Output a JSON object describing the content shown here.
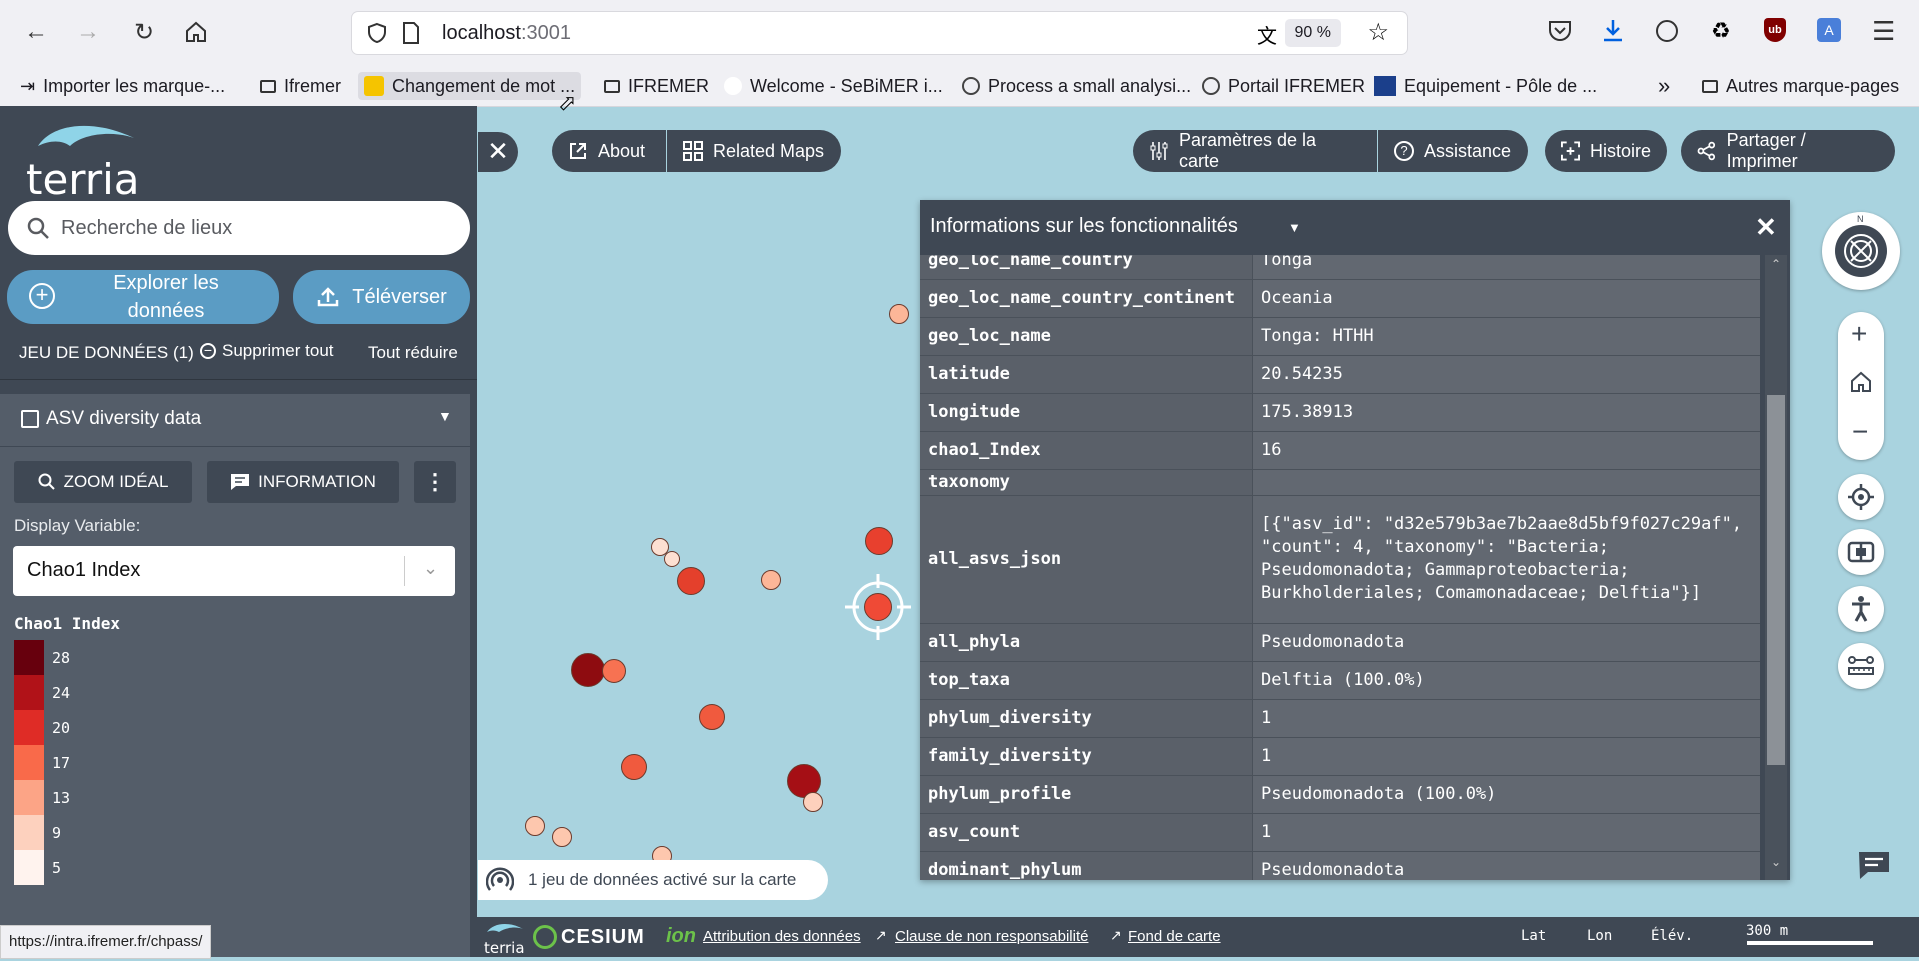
{
  "browser": {
    "url_host": "localhost",
    "url_port": ":3001",
    "zoom": "90 %",
    "bookmarks": [
      {
        "label": "Importer les marque-...",
        "icon": "import-icon"
      },
      {
        "label": "Ifremer",
        "icon": "folder-icon"
      },
      {
        "label": "Changement de mot ...",
        "icon": "ifremer-favicon"
      },
      {
        "label": "IFREMER",
        "icon": "folder-icon"
      },
      {
        "label": "Welcome - SeBiMER i...",
        "icon": "blank-favicon"
      },
      {
        "label": "Process a small analysi...",
        "icon": "globe-icon"
      },
      {
        "label": "Portail IFREMER",
        "icon": "globe-icon"
      },
      {
        "label": "Equipement - Pôle de ...",
        "icon": "site-favicon"
      },
      {
        "label": "Autres marque-pages",
        "icon": "folder-icon"
      }
    ],
    "status_url": "https://intra.ifremer.fr/chpass/"
  },
  "sidebar": {
    "logo_text": "terria",
    "search_placeholder": "Recherche de lieux",
    "explore_label": "Explorer les données",
    "upload_label": "Téléverser",
    "datasets_label": "JEU DE DONNÉES (1)",
    "remove_all_label": "Supprimer tout",
    "collapse_all_label": "Tout réduire",
    "item_title": "ASV diversity data",
    "zoom_label": "ZOOM IDÉAL",
    "info_label": "INFORMATION",
    "display_variable_label": "Display Variable:",
    "display_variable_value": "Chao1 Index",
    "legend_title": "Chao1 Index",
    "legend": [
      {
        "label": "28",
        "color": "#67000d"
      },
      {
        "label": "24",
        "color": "#b11218"
      },
      {
        "label": "20",
        "color": "#df2c26"
      },
      {
        "label": "17",
        "color": "#f96a4a"
      },
      {
        "label": "13",
        "color": "#fca486"
      },
      {
        "label": "9",
        "color": "#fdd1be"
      },
      {
        "label": "5",
        "color": "#fff3ee"
      }
    ]
  },
  "map": {
    "about_label": "About",
    "related_maps_label": "Related Maps",
    "settings_label": "Paramètres de la carte",
    "help_label": "Assistance",
    "story_label": "Histoire",
    "share_label": "Partager / Imprimer",
    "active_datasets": "1 jeu de données activé sur la carte",
    "compass_label": "N"
  },
  "feature_info": {
    "title": "Informations sur les fonctionnalités",
    "rows": [
      {
        "key": "geo_loc_name_country",
        "value": "Tonga"
      },
      {
        "key": "geo_loc_name_country_continent",
        "value": "Oceania"
      },
      {
        "key": "geo_loc_name",
        "value": "Tonga: HTHH"
      },
      {
        "key": "latitude",
        "value": "20.54235"
      },
      {
        "key": "longitude",
        "value": "175.38913"
      },
      {
        "key": "chao1_Index",
        "value": "16"
      },
      {
        "key": "taxonomy",
        "value": ""
      },
      {
        "key": "all_asvs_json",
        "value": "[{\"asv_id\": \"d32e579b3ae7b2aae8d5bf9f027c29af\", \"count\": 4, \"taxonomy\": \"Bacteria; Pseudomonadota; Gammaproteobacteria; Burkholderiales; Comamonadaceae; Delftia\"}]"
      },
      {
        "key": "all_phyla",
        "value": "Pseudomonadota"
      },
      {
        "key": "top_taxa",
        "value": "Delftia (100.0%)"
      },
      {
        "key": "phylum_diversity",
        "value": "1"
      },
      {
        "key": "family_diversity",
        "value": "1"
      },
      {
        "key": "phylum_profile",
        "value": "Pseudomonadota (100.0%)"
      },
      {
        "key": "asv_count",
        "value": "1"
      },
      {
        "key": "dominant_phylum",
        "value": "Pseudomonadota"
      }
    ]
  },
  "bottom": {
    "cesium_label": "CESIUM",
    "ion_label": "ion",
    "attribution": "Attribution des données",
    "disclaimer": "Clause de non responsabilité",
    "basemap": "Fond de carte",
    "lat_label": "Lat",
    "lon_label": "Lon",
    "elev_label": "Élév.",
    "scale_label": "300 m",
    "terria_small": "terria"
  }
}
